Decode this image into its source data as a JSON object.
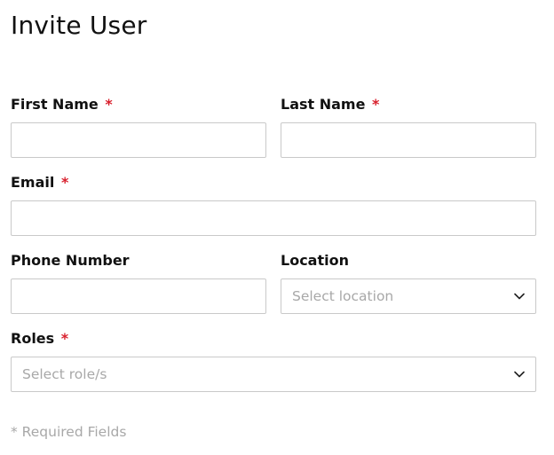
{
  "form": {
    "title": "Invite User",
    "required_marker": "*",
    "fields": {
      "first_name": {
        "label": "First Name",
        "value": "",
        "required": true
      },
      "last_name": {
        "label": "Last Name",
        "value": "",
        "required": true
      },
      "email": {
        "label": "Email",
        "value": "",
        "required": true
      },
      "phone_number": {
        "label": "Phone Number",
        "value": "",
        "required": false
      },
      "location": {
        "label": "Location",
        "placeholder": "Select location",
        "required": false
      },
      "roles": {
        "label": "Roles",
        "placeholder": "Select role/s",
        "required": true
      }
    },
    "footnote": "* Required Fields"
  },
  "icons": {
    "dropdown": "chevron-down-icon"
  },
  "colors": {
    "required": "#d81f2c",
    "placeholder": "#a8a8a8",
    "border": "#c9c9c9",
    "text": "#111111"
  }
}
